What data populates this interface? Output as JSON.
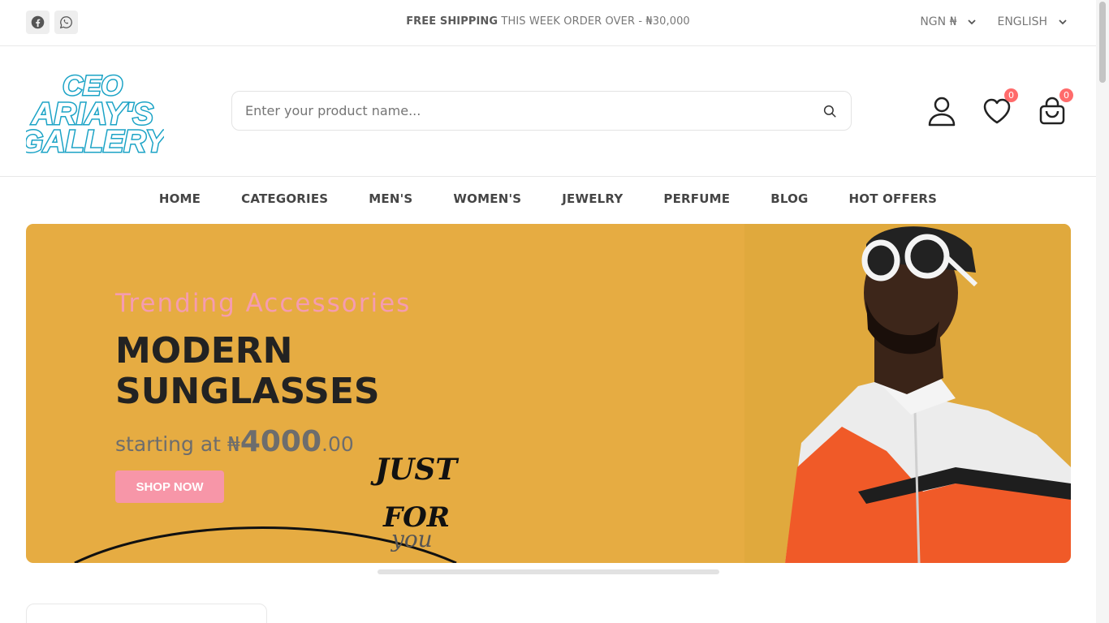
{
  "topbar": {
    "shipping_bold": "FREE SHIPPING",
    "shipping_text": " THIS WEEK ORDER OVER - ₦30,000",
    "currency": "NGN ₦",
    "language": "ENGLISH",
    "social_icons": [
      "facebook-icon",
      "whatsapp-icon"
    ]
  },
  "header": {
    "logo_lines": [
      "CEO",
      "ARIAY'S",
      "GALLERY"
    ],
    "logo_color": "#1ba3c6",
    "search_placeholder": "Enter your product name...",
    "wishlist_count": "0",
    "cart_count": "0"
  },
  "nav": {
    "items": [
      "HOME",
      "CATEGORIES",
      "MEN'S",
      "WOMEN'S",
      "JEWELRY",
      "PERFUME",
      "BLOG",
      "HOT OFFERS"
    ]
  },
  "banner": {
    "subtitle": "Trending Accessories",
    "title": "MODERN SUNGLASSES",
    "price_prefix": "starting at ₦",
    "price_big": "4000",
    "price_suffix": ".00",
    "button": "SHOP NOW",
    "handwriting_1": "JUST",
    "handwriting_2": "FOR",
    "handwriting_3": "you",
    "background_color": "#e6ac42",
    "accent_color": "#f796a8"
  }
}
